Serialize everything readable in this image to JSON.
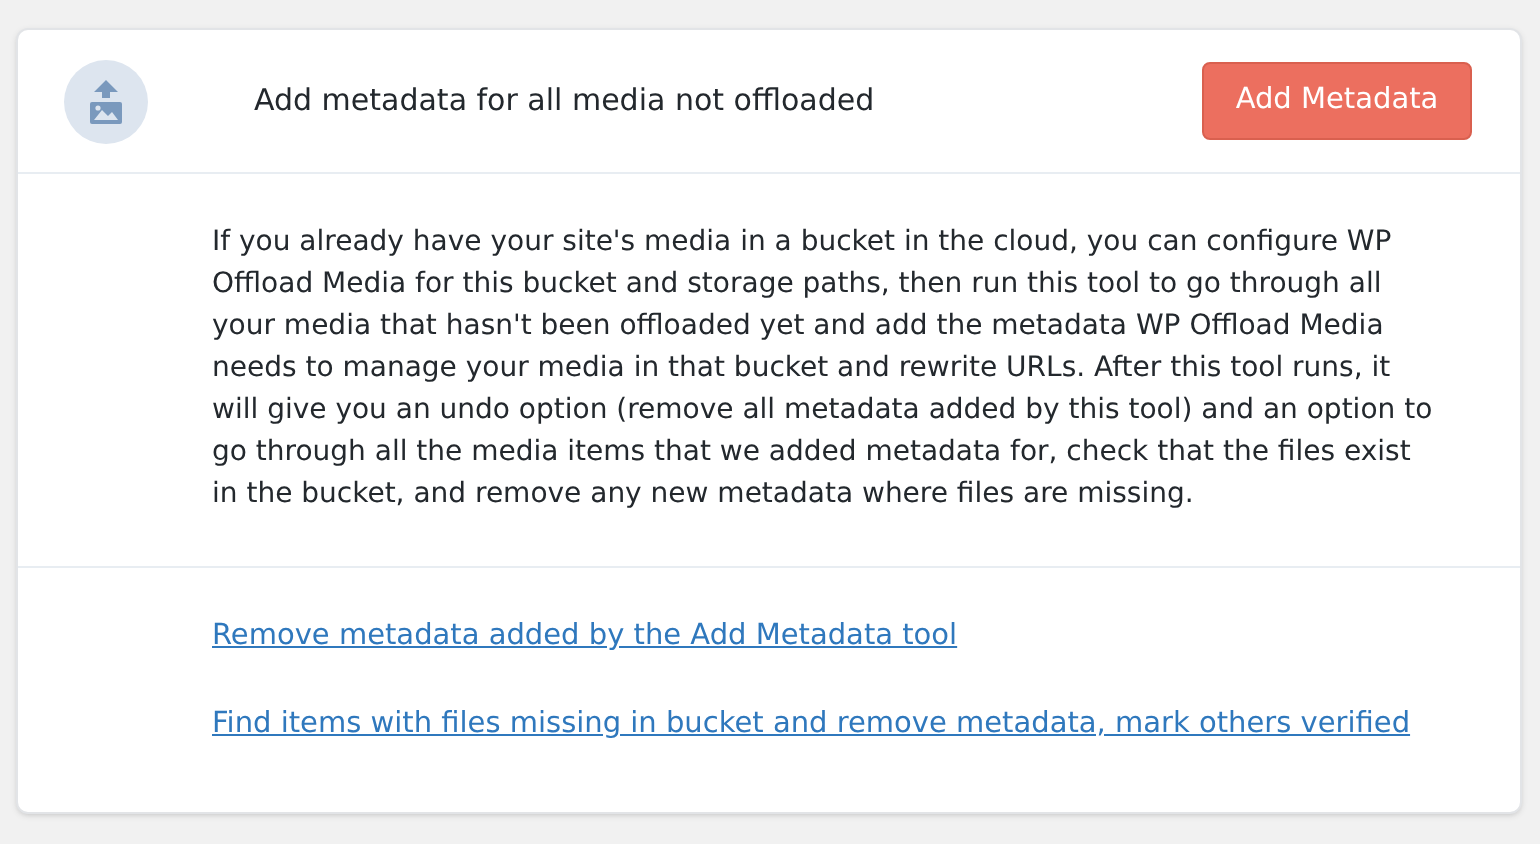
{
  "header": {
    "title": "Add metadata for all media not offloaded",
    "button": "Add Metadata"
  },
  "description": "If you already have your site's media in a bucket in the cloud, you can configure WP Offload Media for this bucket and storage paths, then run this tool to go through all your media that hasn't been offloaded yet and add the metadata WP Offload Media needs to manage your media in that bucket and rewrite URLs. After this tool runs, it will give you an undo option (remove all metadata added by this tool) and an option to go through all the media items that we added metadata for, check that the files exist in the bucket, and remove any new metadata where files are missing.",
  "links": [
    "Remove metadata added by the Add Metadata tool",
    "Find items with files missing in bucket and remove metadata, mark others verified"
  ]
}
